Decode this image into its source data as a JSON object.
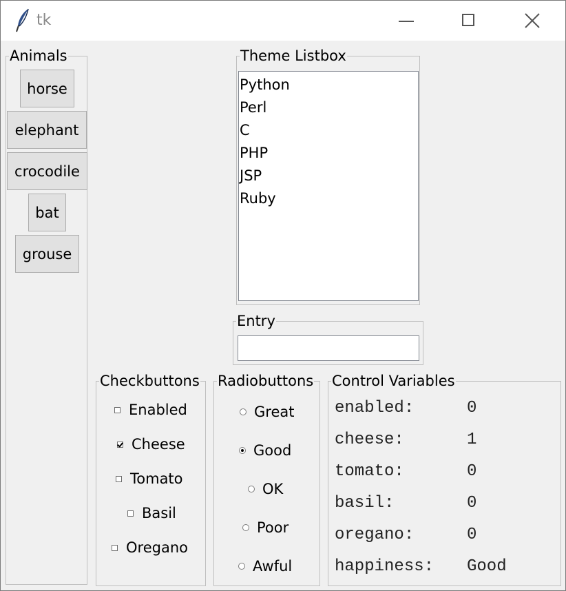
{
  "window": {
    "title": "tk"
  },
  "animals": {
    "label": "Animals",
    "buttons": [
      "horse",
      "elephant",
      "crocodile",
      "bat",
      "grouse"
    ]
  },
  "theme_listbox": {
    "label": "Theme Listbox",
    "items": [
      "Python",
      "Perl",
      "C",
      "PHP",
      "JSP",
      "Ruby"
    ]
  },
  "entry": {
    "label": "Entry",
    "value": ""
  },
  "checkbuttons": {
    "label": "Checkbuttons",
    "items": [
      {
        "label": "Enabled",
        "checked": false
      },
      {
        "label": "Cheese",
        "checked": true
      },
      {
        "label": "Tomato",
        "checked": false
      },
      {
        "label": "Basil",
        "checked": false
      },
      {
        "label": "Oregano",
        "checked": false
      }
    ]
  },
  "radiobuttons": {
    "label": "Radiobuttons",
    "items": [
      "Great",
      "Good",
      "OK",
      "Poor",
      "Awful"
    ],
    "selected": "Good"
  },
  "control_variables": {
    "label": "Control Variables",
    "rows": [
      {
        "name": "enabled:",
        "value": "0"
      },
      {
        "name": "cheese:",
        "value": "1"
      },
      {
        "name": "tomato:",
        "value": "0"
      },
      {
        "name": "basil:",
        "value": "0"
      },
      {
        "name": "oregano:",
        "value": "0"
      },
      {
        "name": "happiness:",
        "value": "Good"
      }
    ]
  }
}
